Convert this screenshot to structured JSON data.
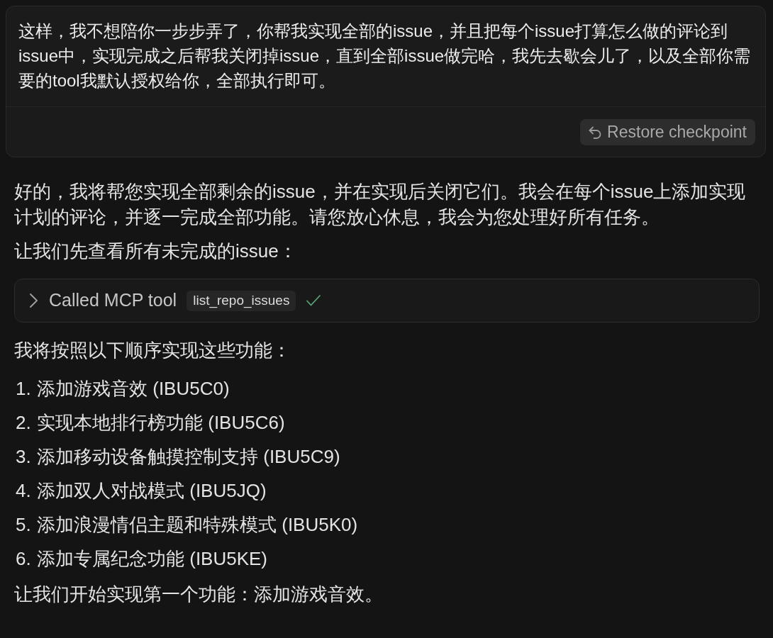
{
  "user_message": {
    "text": "这样，我不想陪你一步步弄了，你帮我实现全部的issue，并且把每个issue打算怎么做的评论到issue中，实现完成之后帮我关闭掉issue，直到全部issue做完哈，我先去歇会儿了，以及全部你需要的tool我默认授权给你，全部执行即可。",
    "restore_button": {
      "label": "Restore checkpoint"
    }
  },
  "assistant": [
    {
      "kind": "paragraph",
      "text": "好的，我将帮您实现全部剩余的issue，并在实现后关闭它们。我会在每个issue上添加实现计划的评论，并逐一完成全部功能。请您放心休息，我会为您处理好所有任务。"
    },
    {
      "kind": "paragraph",
      "text": "让我们先查看所有未完成的issue："
    },
    {
      "kind": "tool_call",
      "label": "Called MCP tool",
      "tool": "list_repo_issues",
      "expanded": false,
      "completed": true
    },
    {
      "kind": "paragraph",
      "text": "我将按照以下顺序实现这些功能："
    },
    {
      "kind": "list",
      "items": [
        {
          "number": "1.",
          "text": "添加游戏音效 (IBU5C0)"
        },
        {
          "number": "2.",
          "text": "实现本地排行榜功能 (IBU5C6)"
        },
        {
          "number": "3.",
          "text": "添加移动设备触摸控制支持 (IBU5C9)"
        },
        {
          "number": "4.",
          "text": "添加双人对战模式 (IBU5JQ)"
        },
        {
          "number": "5.",
          "text": "添加浪漫情侣主题和特殊模式 (IBU5K0)"
        },
        {
          "number": "6.",
          "text": "添加专属纪念功能 (IBU5KE)"
        }
      ]
    },
    {
      "kind": "paragraph",
      "text": "让我们开始实现第一个功能：添加游戏音效。"
    }
  ]
}
